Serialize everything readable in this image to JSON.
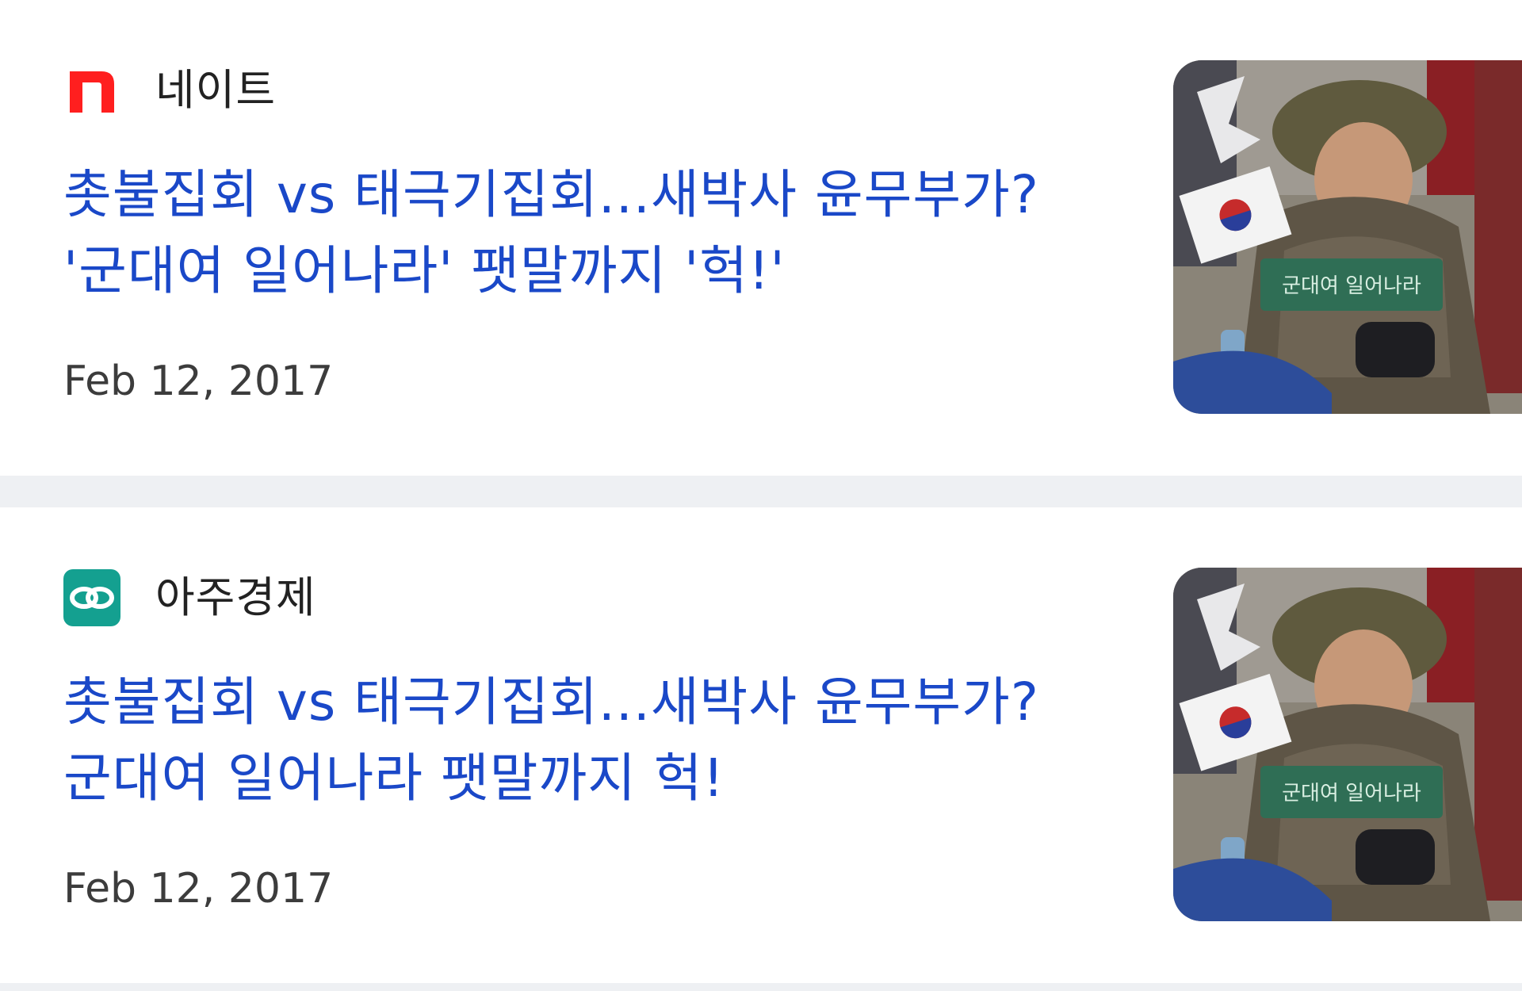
{
  "articles": [
    {
      "source": "네이트",
      "logo_icon": "nate-logo-icon",
      "logo_color": "#ff1f1f",
      "title": "촛불집회 vs 태극기집회...새박사 윤무부가? '군대여 일어나라' 팻말까지 '헉!'",
      "date": "Feb 12, 2017",
      "thumbnail_sign_text": "군대여 일어나라"
    },
    {
      "source": "아주경제",
      "logo_icon": "ajou-logo-icon",
      "logo_color": "#14a090",
      "title": "촛불집회 vs 태극기집회...새박사 윤무부가? 군대여 일어나라 팻말까지 헉!",
      "date": "Feb 12, 2017",
      "thumbnail_sign_text": "군대여 일어나라"
    }
  ],
  "colors": {
    "title": "#1a48c8",
    "source": "#222222",
    "date": "#3c3c3c",
    "separator": "#eef0f3"
  }
}
